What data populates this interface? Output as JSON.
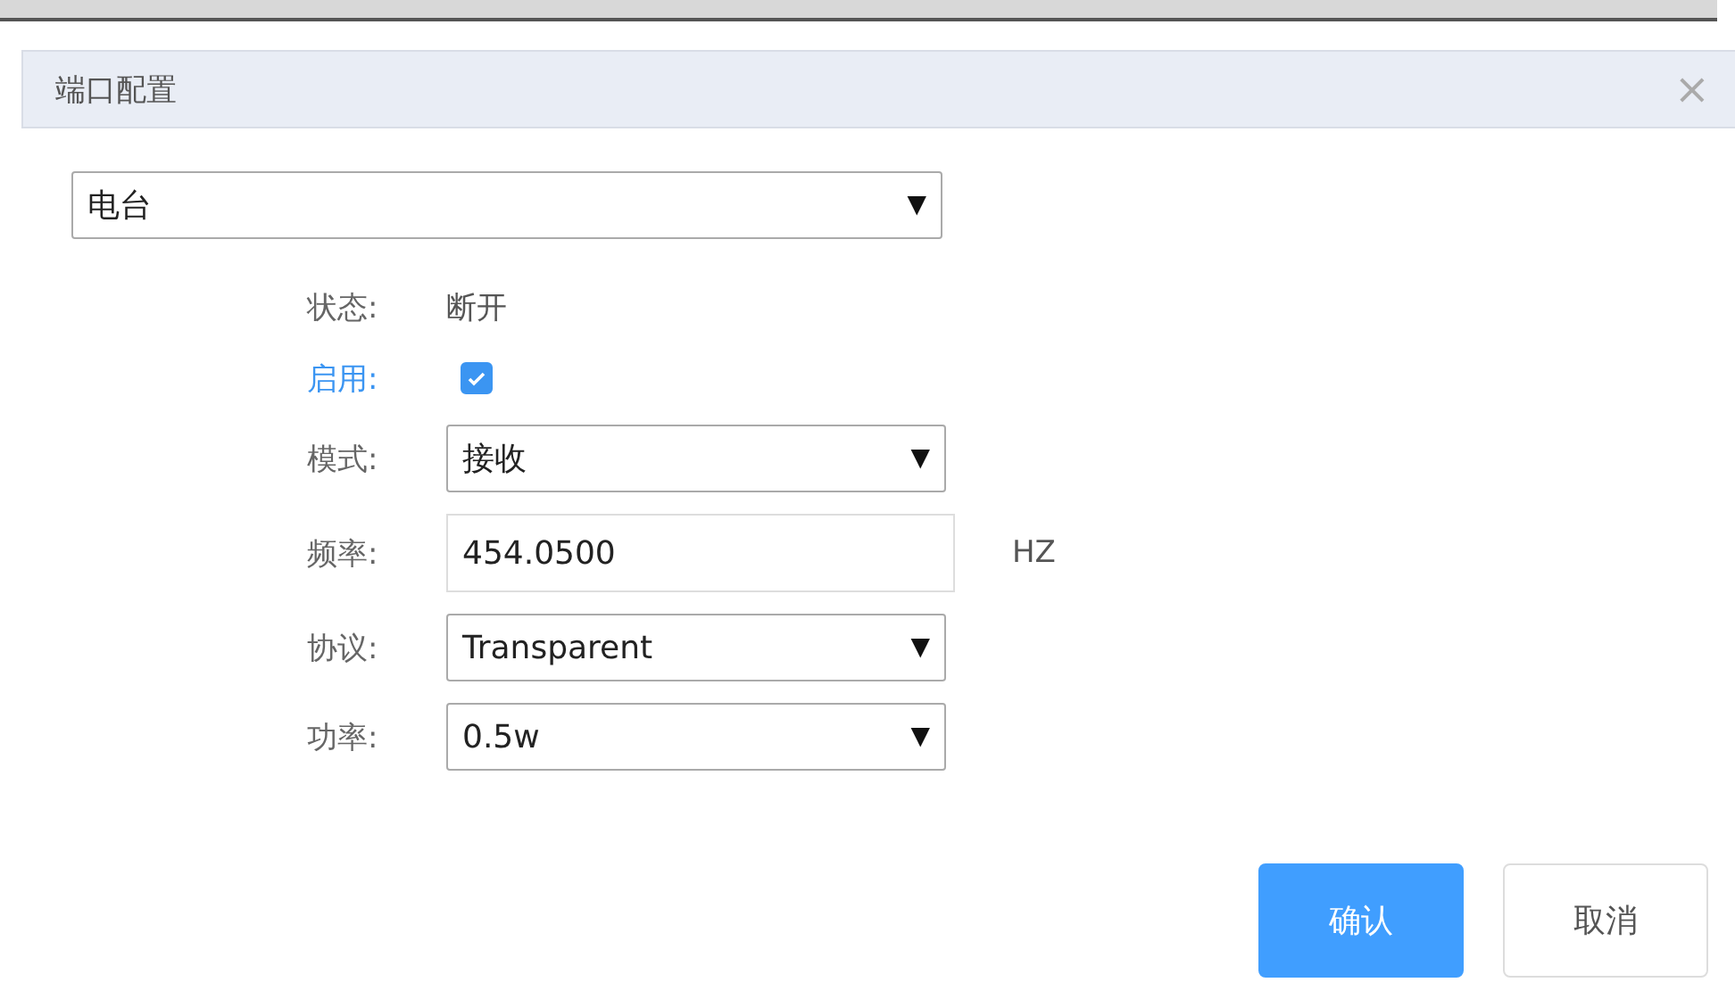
{
  "dialog": {
    "title": "端口配置",
    "close": "×"
  },
  "port_select": {
    "value": "电台",
    "arrow": "▼"
  },
  "fields": [
    {
      "kind": "text",
      "label": "状态:",
      "value": "断开"
    },
    {
      "kind": "checkbox",
      "label": "启用:",
      "checked": true
    },
    {
      "kind": "select",
      "label": "模式:",
      "value": "接收",
      "arrow": "▼"
    },
    {
      "kind": "input",
      "label": "频率:",
      "value": "454.0500",
      "unit": "HZ"
    },
    {
      "kind": "select",
      "label": "协议:",
      "value": "Transparent",
      "arrow": "▼"
    },
    {
      "kind": "select",
      "label": "功率:",
      "value": "0.5w",
      "arrow": "▼"
    }
  ],
  "buttons": [
    {
      "label": "确认",
      "kind": "primary"
    },
    {
      "label": "取消",
      "kind": "default"
    }
  ]
}
